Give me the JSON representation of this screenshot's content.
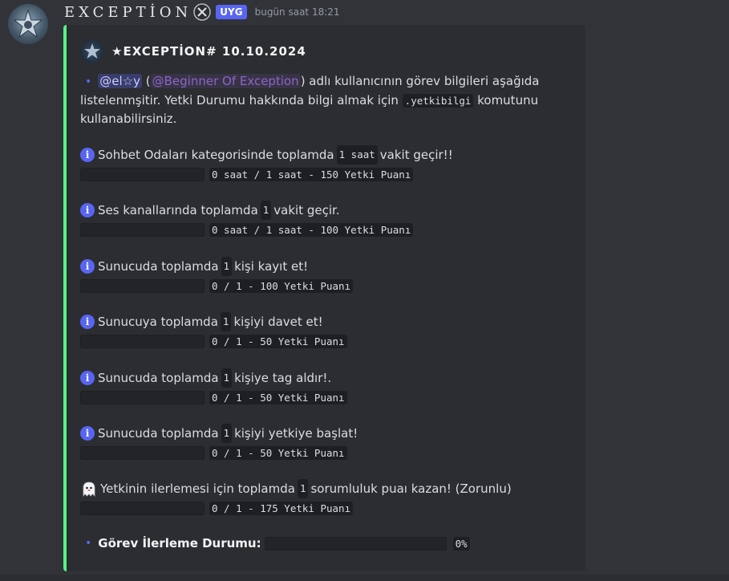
{
  "message": {
    "username": "EXCEPTİON",
    "app_tag": "UYG",
    "timestamp": "bugün saat 18:21",
    "avatar_icon": "star-emblem-icon",
    "badge_icon": "crossed-tools-icon"
  },
  "embed": {
    "accent_color": "#57f287",
    "author": "★EXCEPTİON# 10.10.2024",
    "description": {
      "bullet": "•",
      "user_mention": "@el☆y",
      "open_paren": " (",
      "role_mention": "@Beginner Of Exception",
      "text_1": ") adlı kullanıcının görev bilgileri aşağıda listelenmşitir. Yetki Durumu hakkında bilgi almak için ",
      "command": ".yetkibilgi",
      "text_2": " komutunu kullanabilirsiniz."
    },
    "tasks": [
      {
        "icon": "info-icon",
        "before": "Sohbet Odaları kategorisinde toplamda ",
        "code": "1 saat",
        "after": " vakit geçir!!",
        "progress": 0,
        "progress_text": "0 saat / 1 saat - 150 Yetki Puanı"
      },
      {
        "icon": "info-icon",
        "before": "Ses kanallarında toplamda",
        "code": "1",
        "after": "vakit geçir.",
        "progress": 0,
        "progress_text": "0 saat / 1 saat - 100 Yetki Puanı"
      },
      {
        "icon": "info-icon",
        "before": "Sunucuda toplamda",
        "code": "1",
        "after": "kişi kayıt et!",
        "progress": 0,
        "progress_text": "0 / 1 - 100 Yetki Puanı"
      },
      {
        "icon": "info-icon",
        "before": "Sunucuya toplamda",
        "code": "1",
        "after": "kişiyi davet et!",
        "progress": 0,
        "progress_text": "0 / 1 - 50 Yetki Puanı"
      },
      {
        "icon": "info-icon",
        "before": "Sunucuda toplamda",
        "code": "1",
        "after": "kişiye tag aldır!.",
        "progress": 0,
        "progress_text": "0 / 1 - 50 Yetki Puanı"
      },
      {
        "icon": "info-icon",
        "before": "Sunucuda toplamda",
        "code": "1",
        "after": "kişiyi yetkiye başlat!",
        "progress": 0,
        "progress_text": "0 / 1 - 50 Yetki Puanı"
      },
      {
        "icon": "ghost-icon",
        "before": "Yetkinin ilerlemesi için toplamda",
        "code": "1",
        "after": "sorumluluk puaı kazan! (Zorunlu)",
        "progress": 0,
        "progress_text": "0 / 1 - 175 Yetki Puanı"
      }
    ],
    "overall": {
      "bullet": "•",
      "label": "Görev İlerleme Durumu:",
      "progress": 0,
      "percent_text": "0%"
    }
  }
}
